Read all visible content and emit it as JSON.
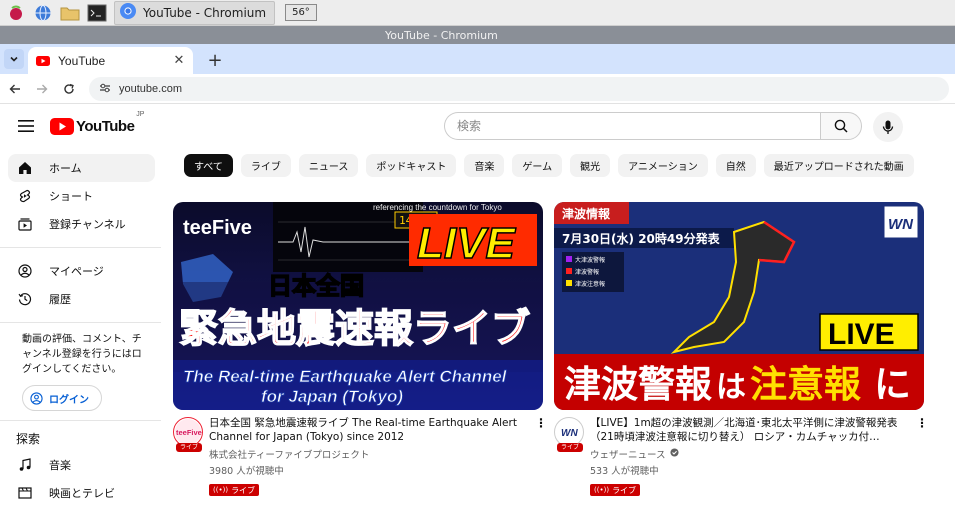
{
  "taskbar": {
    "app_title": "YouTube - Chromium",
    "temperature": "56°",
    "icons": [
      "raspberry-pi-menu-icon",
      "web-browser-icon",
      "file-manager-icon",
      "terminal-icon",
      "chromium-icon"
    ]
  },
  "window": {
    "title": "YouTube - Chromium"
  },
  "browser": {
    "tab_title": "YouTube",
    "address": "youtube.com"
  },
  "youtube": {
    "wordmark": "YouTube",
    "region": "JP",
    "search_placeholder": "検索"
  },
  "sidebar": {
    "primary": [
      {
        "label": "ホーム",
        "icon": "home-icon"
      },
      {
        "label": "ショート",
        "icon": "shorts-icon"
      },
      {
        "label": "登録チャンネル",
        "icon": "subscriptions-icon"
      }
    ],
    "secondary": [
      {
        "label": "マイページ",
        "icon": "account-icon"
      },
      {
        "label": "履歴",
        "icon": "history-icon"
      }
    ],
    "signin_note": "動画の評価、コメント、チャンネル登録を行うにはログインしてください。",
    "login_label": "ログイン",
    "explore_heading": "探索",
    "explore": [
      {
        "label": "音楽",
        "icon": "music-icon"
      },
      {
        "label": "映画とテレビ",
        "icon": "movies-icon"
      }
    ]
  },
  "chips": [
    "すべて",
    "ライブ",
    "ニュース",
    "ポッドキャスト",
    "音楽",
    "ゲーム",
    "観光",
    "アニメーション",
    "自然",
    "最近アップロードされた動画"
  ],
  "videos": [
    {
      "title": "日本全国 緊急地震速報ライブ The Real-time Earthquake Alert Channel for Japan (Tokyo) since 2012",
      "channel": "株式会社ティーファイブプロジェクト",
      "views": "3980 人が視聴中",
      "live_label": "ライブ",
      "avatar_text": "teeFive",
      "avatar_badge": "ライブ",
      "thumb": {
        "brand": "teeFive",
        "live": "LIVE",
        "line1": "日本全国",
        "line2": "緊急地震速報ライブ",
        "line3": "The Real-time Earthquake Alert Channel",
        "line4": "for Japan (Tokyo)",
        "time": "14:00",
        "ticker": "referencing the countdown for Tokyo"
      }
    },
    {
      "title": "【LIVE】1m超の津波観測／北海道･東北太平洋側に津波警報発表（21時頃津波注意報に切り替え） ロシア・カムチャッカ付…",
      "channel": "ウェザーニュース",
      "views": "533 人が視聴中",
      "live_label": "ライブ",
      "avatar_text": "WN",
      "avatar_badge": "ライブ",
      "verified": true,
      "thumb": {
        "heading": "津波情報",
        "date": "7月30日(水) 20時49分発表",
        "legend": [
          "大津波警報",
          "津波警報",
          "津波注意報"
        ],
        "legend_colors": [
          "#a020f0",
          "#ff2020",
          "#ffe000"
        ],
        "logo": "WN",
        "live": "LIVE",
        "banner_a": "津波警報",
        "banner_b": "は",
        "banner_c": "注意報",
        "banner_d": "に"
      }
    }
  ],
  "colors": {
    "youtube_red": "#ff0000",
    "live_red": "#cc0000",
    "link_blue": "#065fd4",
    "tab_strip": "#d3e3fd"
  }
}
